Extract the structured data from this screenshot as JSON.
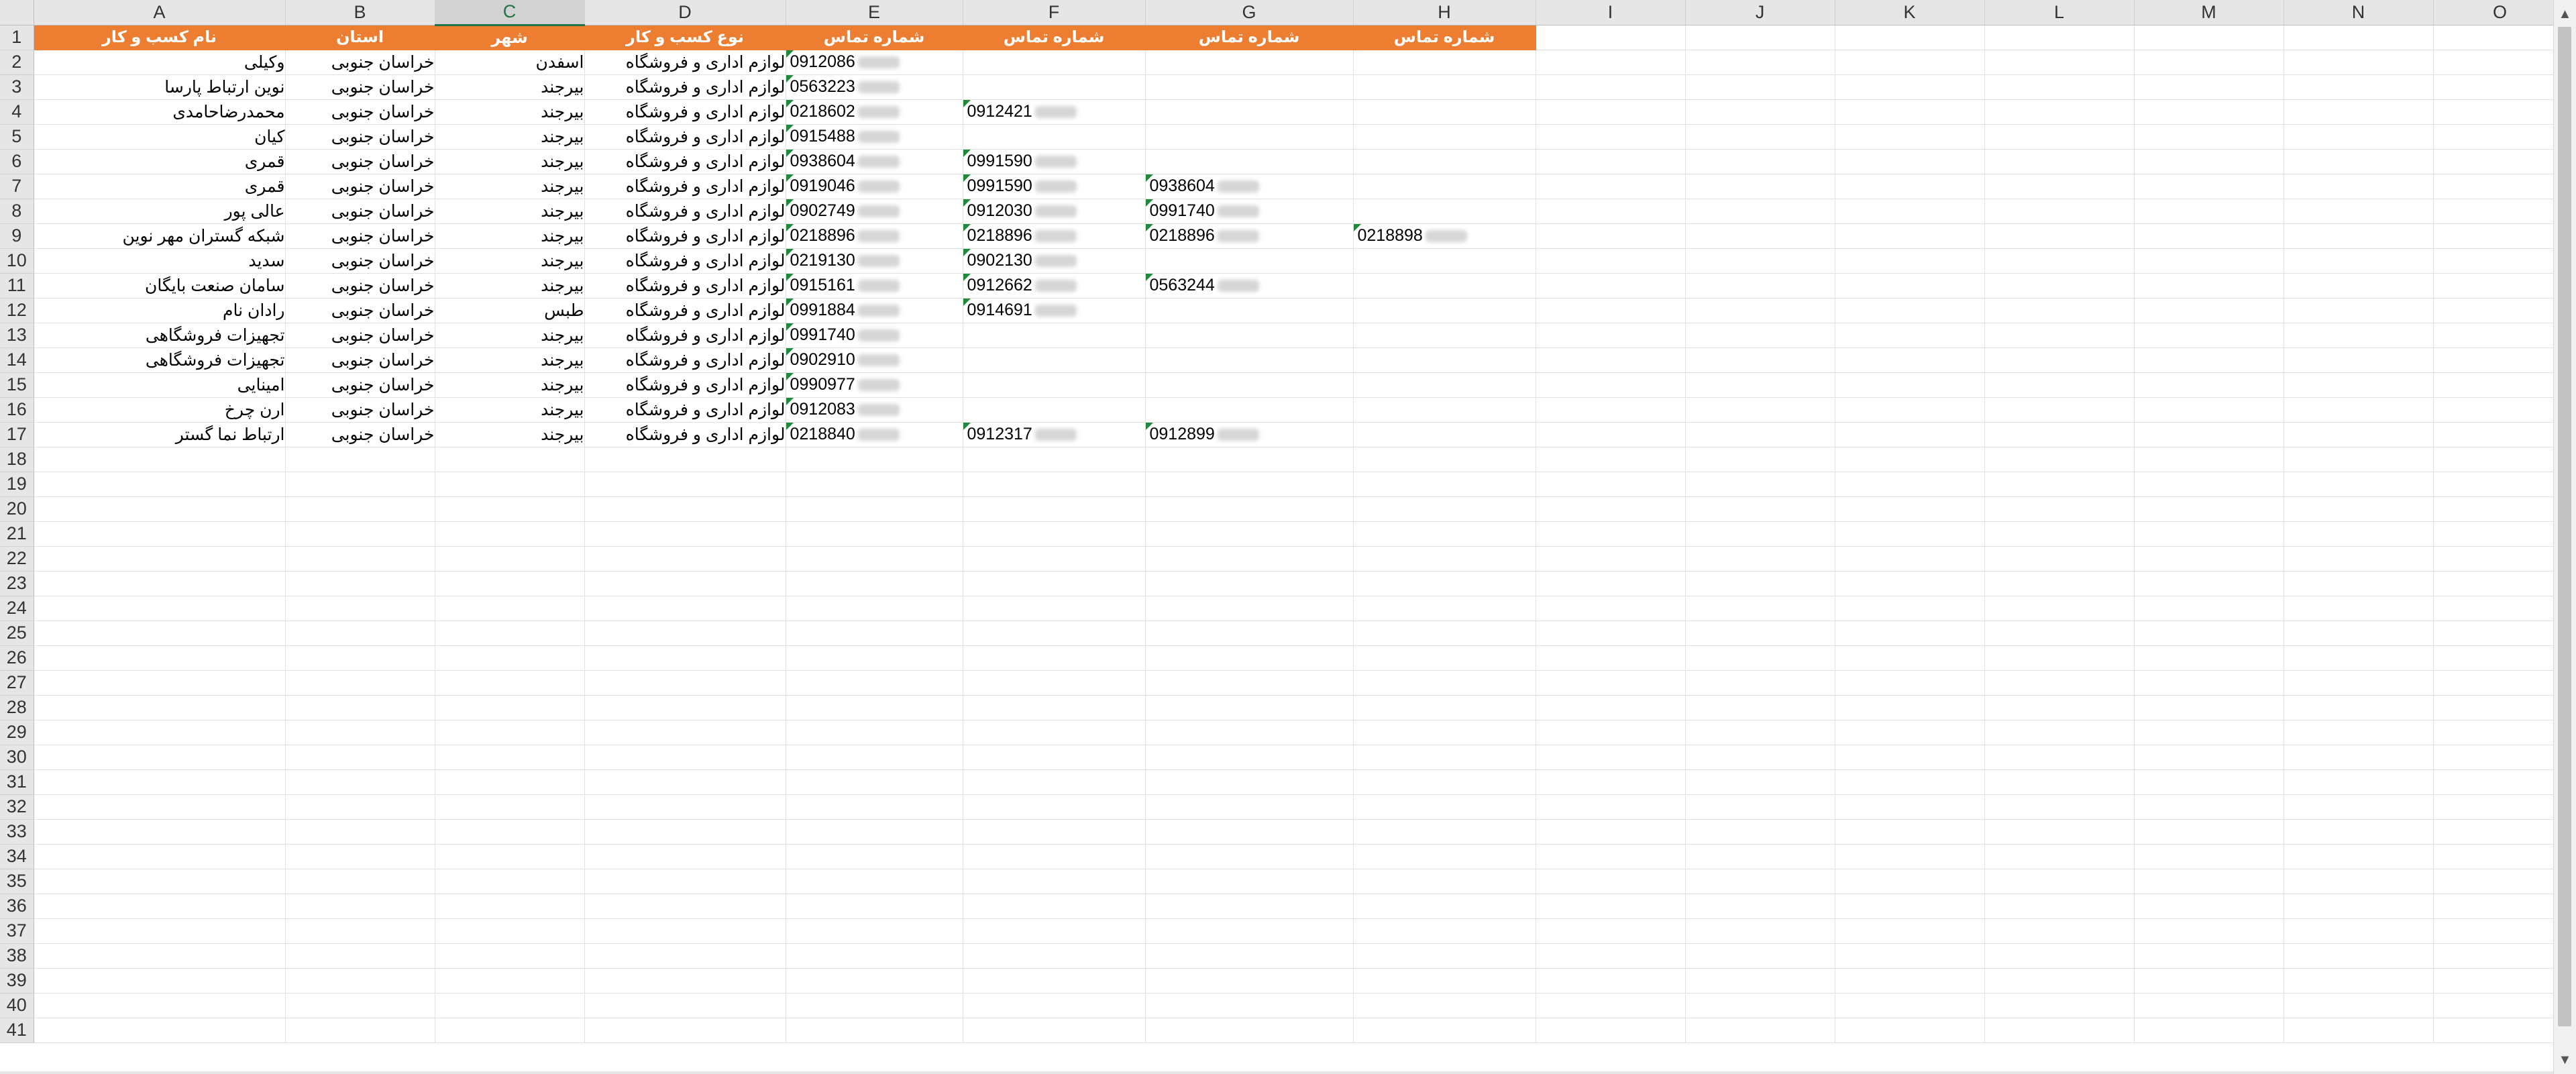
{
  "columns": [
    "A",
    "B",
    "C",
    "D",
    "E",
    "F",
    "G",
    "H",
    "I",
    "J",
    "K",
    "L",
    "M",
    "N",
    "O"
  ],
  "selected_column": "C",
  "header": [
    "نام کسب و کار",
    "استان",
    "شهر",
    "نوع کسب و کار",
    "شماره تماس",
    "شماره تماس",
    "شماره تماس",
    "شماره تماس"
  ],
  "rows": [
    {
      "name": "وکیلی",
      "province": "خراسان جنوبی",
      "city": "اسفدن",
      "type": "لوازم اداری و فروشگاه",
      "phones": [
        "0912086",
        "",
        "",
        ""
      ]
    },
    {
      "name": "نوین ارتباط پارسا",
      "province": "خراسان جنوبی",
      "city": "بیرجند",
      "type": "لوازم اداری و فروشگاه",
      "phones": [
        "0563223",
        "",
        "",
        ""
      ]
    },
    {
      "name": "محمدرضاحامدی",
      "province": "خراسان جنوبی",
      "city": "بیرجند",
      "type": "لوازم اداری و فروشگاه",
      "phones": [
        "0218602",
        "0912421",
        "",
        ""
      ]
    },
    {
      "name": "کیان",
      "province": "خراسان جنوبی",
      "city": "بیرجند",
      "type": "لوازم اداری و فروشگاه",
      "phones": [
        "0915488",
        "",
        "",
        ""
      ]
    },
    {
      "name": "قمری",
      "province": "خراسان جنوبی",
      "city": "بیرجند",
      "type": "لوازم اداری و فروشگاه",
      "phones": [
        "0938604",
        "0991590",
        "",
        ""
      ]
    },
    {
      "name": "قمری",
      "province": "خراسان جنوبی",
      "city": "بیرجند",
      "type": "لوازم اداری و فروشگاه",
      "phones": [
        "0919046",
        "0991590",
        "0938604",
        ""
      ]
    },
    {
      "name": "عالی پور",
      "province": "خراسان جنوبی",
      "city": "بیرجند",
      "type": "لوازم اداری و فروشگاه",
      "phones": [
        "0902749",
        "0912030",
        "0991740",
        ""
      ]
    },
    {
      "name": "شبکه گستران مهر نوین",
      "province": "خراسان جنوبی",
      "city": "بیرجند",
      "type": "لوازم اداری و فروشگاه",
      "phones": [
        "0218896",
        "0218896",
        "0218896",
        "0218898"
      ]
    },
    {
      "name": "سدید",
      "province": "خراسان جنوبی",
      "city": "بیرجند",
      "type": "لوازم اداری و فروشگاه",
      "phones": [
        "0219130",
        "0902130",
        "",
        ""
      ]
    },
    {
      "name": "سامان صنعت بایگان",
      "province": "خراسان جنوبی",
      "city": "بیرجند",
      "type": "لوازم اداری و فروشگاه",
      "phones": [
        "0915161",
        "0912662",
        "0563244",
        ""
      ]
    },
    {
      "name": "رادان نام",
      "province": "خراسان جنوبی",
      "city": "طبس",
      "type": "لوازم اداری و فروشگاه",
      "phones": [
        "0991884",
        "0914691",
        "",
        ""
      ]
    },
    {
      "name": "تجهیزات فروشگاهی",
      "province": "خراسان جنوبی",
      "city": "بیرجند",
      "type": "لوازم اداری و فروشگاه",
      "phones": [
        "0991740",
        "",
        "",
        ""
      ]
    },
    {
      "name": "تجهیزات فروشگاهی",
      "province": "خراسان جنوبی",
      "city": "بیرجند",
      "type": "لوازم اداری و فروشگاه",
      "phones": [
        "0902910",
        "",
        "",
        ""
      ]
    },
    {
      "name": "امینایی",
      "province": "خراسان جنوبی",
      "city": "بیرجند",
      "type": "لوازم اداری و فروشگاه",
      "phones": [
        "0990977",
        "",
        "",
        ""
      ]
    },
    {
      "name": "ارن چرخ",
      "province": "خراسان جنوبی",
      "city": "بیرجند",
      "type": "لوازم اداری و فروشگاه",
      "phones": [
        "0912083",
        "",
        "",
        ""
      ]
    },
    {
      "name": "ارتباط نما گستر",
      "province": "خراسان جنوبی",
      "city": "بیرجند",
      "type": "لوازم اداری و فروشگاه",
      "phones": [
        "0218840",
        "0912317",
        "0912899",
        ""
      ]
    }
  ],
  "total_rows": 41,
  "colors": {
    "header_fill": "#ed7d31",
    "header_text": "#ffffff",
    "selected_col": "#217346",
    "error_triangle": "#1f8a3c"
  }
}
